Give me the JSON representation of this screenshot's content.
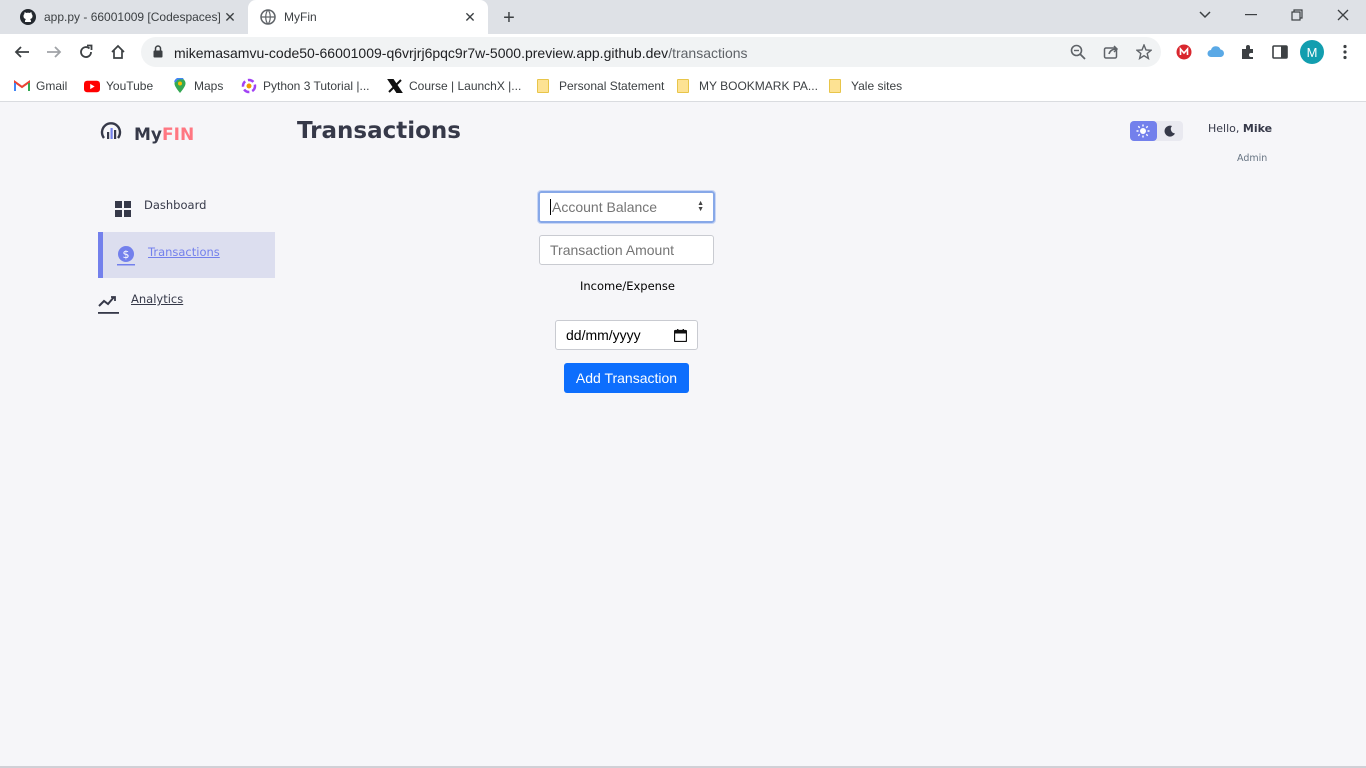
{
  "browser": {
    "tabs": [
      {
        "title": "app.py - 66001009 [Codespaces]",
        "icon": "github-icon",
        "active": false
      },
      {
        "title": "MyFin",
        "icon": "globe-icon",
        "active": true
      }
    ],
    "url_host": "mikemasamvu-code50-66001009-q6vrjrj6pqc9r7w-5000.preview.app.github.dev",
    "url_path": "/transactions",
    "profile_initial": "M",
    "bookmarks": [
      {
        "label": "Gmail",
        "icon": "gmail-icon"
      },
      {
        "label": "YouTube",
        "icon": "youtube-icon"
      },
      {
        "label": "Maps",
        "icon": "maps-icon"
      },
      {
        "label": "Python 3 Tutorial |...",
        "icon": "python-tutorial-icon"
      },
      {
        "label": "Course | LaunchX |...",
        "icon": "launchx-icon"
      },
      {
        "label": "Personal Statement",
        "icon": "folder-icon"
      },
      {
        "label": "MY BOOKMARK PA...",
        "icon": "folder-icon"
      },
      {
        "label": "Yale sites",
        "icon": "folder-icon"
      }
    ]
  },
  "app": {
    "logo": {
      "my": "My",
      "fin": "FIN"
    },
    "page_title": "Transactions",
    "sidebar": {
      "items": [
        {
          "label": "Dashboard",
          "icon": "dashboard-grid-icon",
          "active": false
        },
        {
          "label": "Transactions",
          "icon": "dollar-coin-icon",
          "active": true
        },
        {
          "label": "Analytics",
          "icon": "analytics-chart-icon",
          "active": false
        }
      ]
    },
    "profile": {
      "greeting": "Hello,",
      "name": "Mike",
      "role": "Admin"
    },
    "form": {
      "account_balance_placeholder": "Account Balance",
      "transaction_amount_placeholder": "Transaction Amount",
      "income_expense_label": "Income/Expense",
      "date_placeholder": "dd/mm/yyyy",
      "submit_label": "Add Transaction"
    },
    "colors": {
      "primary": "#7380ec",
      "accent": "#ff7782",
      "button": "#0d6efd",
      "background": "#f6f6f9",
      "text": "#363949"
    }
  }
}
